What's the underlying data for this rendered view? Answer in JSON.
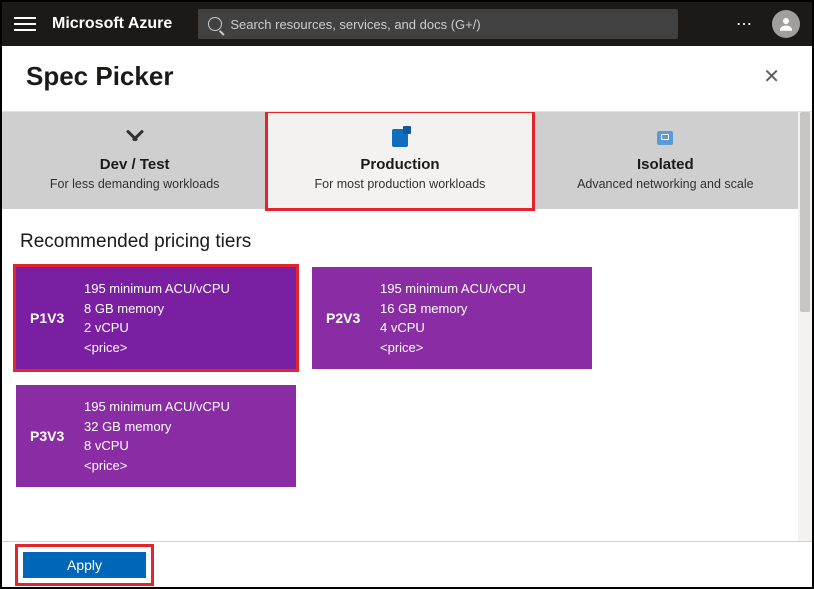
{
  "topbar": {
    "brand": "Microsoft Azure",
    "search_placeholder": "Search resources, services, and docs (G+/)"
  },
  "blade": {
    "title": "Spec Picker"
  },
  "tabs": [
    {
      "title": "Dev / Test",
      "subtitle": "For less demanding workloads"
    },
    {
      "title": "Production",
      "subtitle": "For most production workloads"
    },
    {
      "title": "Isolated",
      "subtitle": "Advanced networking and scale"
    }
  ],
  "section_title": "Recommended pricing tiers",
  "tiers": [
    {
      "sku": "P1V3",
      "acu": "195 minimum ACU/vCPU",
      "memory": "8 GB memory",
      "cpu": "2 vCPU",
      "price": "<price>",
      "selected": true
    },
    {
      "sku": "P2V3",
      "acu": "195 minimum ACU/vCPU",
      "memory": "16 GB memory",
      "cpu": "4 vCPU",
      "price": "<price>",
      "selected": false
    },
    {
      "sku": "P3V3",
      "acu": "195 minimum ACU/vCPU",
      "memory": "32 GB memory",
      "cpu": "8 vCPU",
      "price": "<price>",
      "selected": false
    }
  ],
  "apply_label": "Apply"
}
